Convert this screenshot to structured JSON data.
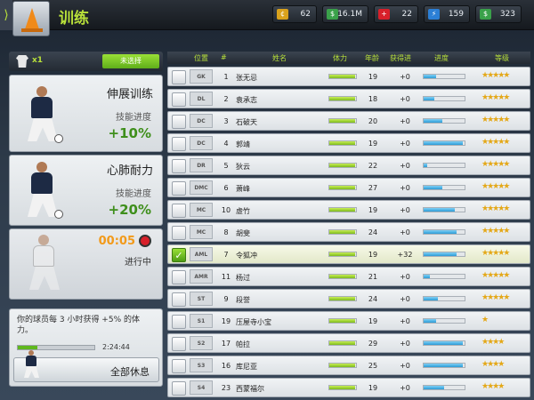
{
  "header": {
    "title": "训练",
    "back_glyph": "⟩",
    "stats": [
      {
        "icon": "coin-icon",
        "value": "62",
        "color": "#d9a21c"
      },
      {
        "icon": "money-icon",
        "value": "16.1M",
        "color": "#3aa14a"
      },
      {
        "icon": "medical-icon",
        "value": "22",
        "color": "#d8202a"
      },
      {
        "icon": "energy-icon",
        "value": "159",
        "color": "#2b7fd6"
      },
      {
        "icon": "cash-icon",
        "value": "323",
        "color": "#3aa14a"
      }
    ]
  },
  "left": {
    "shirt_count": "x1",
    "unselected_label": "未选择",
    "drills": [
      {
        "title": "伸展训练",
        "sub": "技能进度",
        "value": "+10%"
      },
      {
        "title": "心肺耐力",
        "sub": "技能进度",
        "value": "+20%"
      }
    ],
    "active": {
      "timer": "00:05",
      "status": "进行中"
    },
    "rest": {
      "text": "你的球员每 3 小时获得 +5% 的体力。",
      "progress": 0.25,
      "time": "2:24:44",
      "button_label": "全部休息"
    }
  },
  "table": {
    "headers": [
      "位置",
      "#",
      "姓名",
      "体力",
      "年龄",
      "获得进",
      "进度",
      "等级"
    ],
    "rows": [
      {
        "pos": "GK",
        "num": "1",
        "name": "张无忌",
        "stamina": 0.95,
        "age": "19",
        "gain": "+0",
        "progress": 0.3,
        "stars": 5,
        "checked": false
      },
      {
        "pos": "DL",
        "num": "2",
        "name": "袁承志",
        "stamina": 0.95,
        "age": "18",
        "gain": "+0",
        "progress": 0.25,
        "stars": 5,
        "checked": false
      },
      {
        "pos": "DC",
        "num": "3",
        "name": "石破天",
        "stamina": 0.95,
        "age": "20",
        "gain": "+0",
        "progress": 0.45,
        "stars": 5,
        "checked": false
      },
      {
        "pos": "DC",
        "num": "4",
        "name": "郭靖",
        "stamina": 0.95,
        "age": "19",
        "gain": "+0",
        "progress": 0.95,
        "stars": 5,
        "checked": false
      },
      {
        "pos": "DR",
        "num": "5",
        "name": "狄云",
        "stamina": 0.95,
        "age": "22",
        "gain": "+0",
        "progress": 0.08,
        "stars": 5,
        "checked": false
      },
      {
        "pos": "DMC",
        "num": "6",
        "name": "萧峰",
        "stamina": 0.95,
        "age": "27",
        "gain": "+0",
        "progress": 0.45,
        "stars": 5,
        "checked": false
      },
      {
        "pos": "MC",
        "num": "10",
        "name": "虚竹",
        "stamina": 0.95,
        "age": "19",
        "gain": "+0",
        "progress": 0.75,
        "stars": 5,
        "checked": false
      },
      {
        "pos": "MC",
        "num": "8",
        "name": "胡斐",
        "stamina": 0.95,
        "age": "24",
        "gain": "+0",
        "progress": 0.8,
        "stars": 5,
        "checked": false
      },
      {
        "pos": "AML",
        "num": "7",
        "name": "令狐冲",
        "stamina": 0.95,
        "age": "19",
        "gain": "+32",
        "progress": 0.8,
        "stars": 5,
        "checked": true
      },
      {
        "pos": "AMR",
        "num": "11",
        "name": "杨过",
        "stamina": 0.95,
        "age": "21",
        "gain": "+0",
        "progress": 0.15,
        "stars": 5,
        "checked": false
      },
      {
        "pos": "ST",
        "num": "9",
        "name": "段誉",
        "stamina": 0.95,
        "age": "24",
        "gain": "+0",
        "progress": 0.35,
        "stars": 5,
        "checked": false
      },
      {
        "pos": "S1",
        "num": "19",
        "name": "压屋寺小宝",
        "stamina": 0.95,
        "age": "19",
        "gain": "+0",
        "progress": 0.3,
        "stars": 1,
        "checked": false
      },
      {
        "pos": "S2",
        "num": "17",
        "name": "帕拉",
        "stamina": 0.95,
        "age": "29",
        "gain": "+0",
        "progress": 0.95,
        "stars": 4,
        "checked": false
      },
      {
        "pos": "S3",
        "num": "16",
        "name": "库尼亚",
        "stamina": 0.95,
        "age": "25",
        "gain": "+0",
        "progress": 0.95,
        "stars": 4,
        "checked": false
      },
      {
        "pos": "S4",
        "num": "23",
        "name": "西蒙福尔",
        "stamina": 0.95,
        "age": "19",
        "gain": "+0",
        "progress": 0.5,
        "stars": 4,
        "checked": false
      }
    ]
  }
}
